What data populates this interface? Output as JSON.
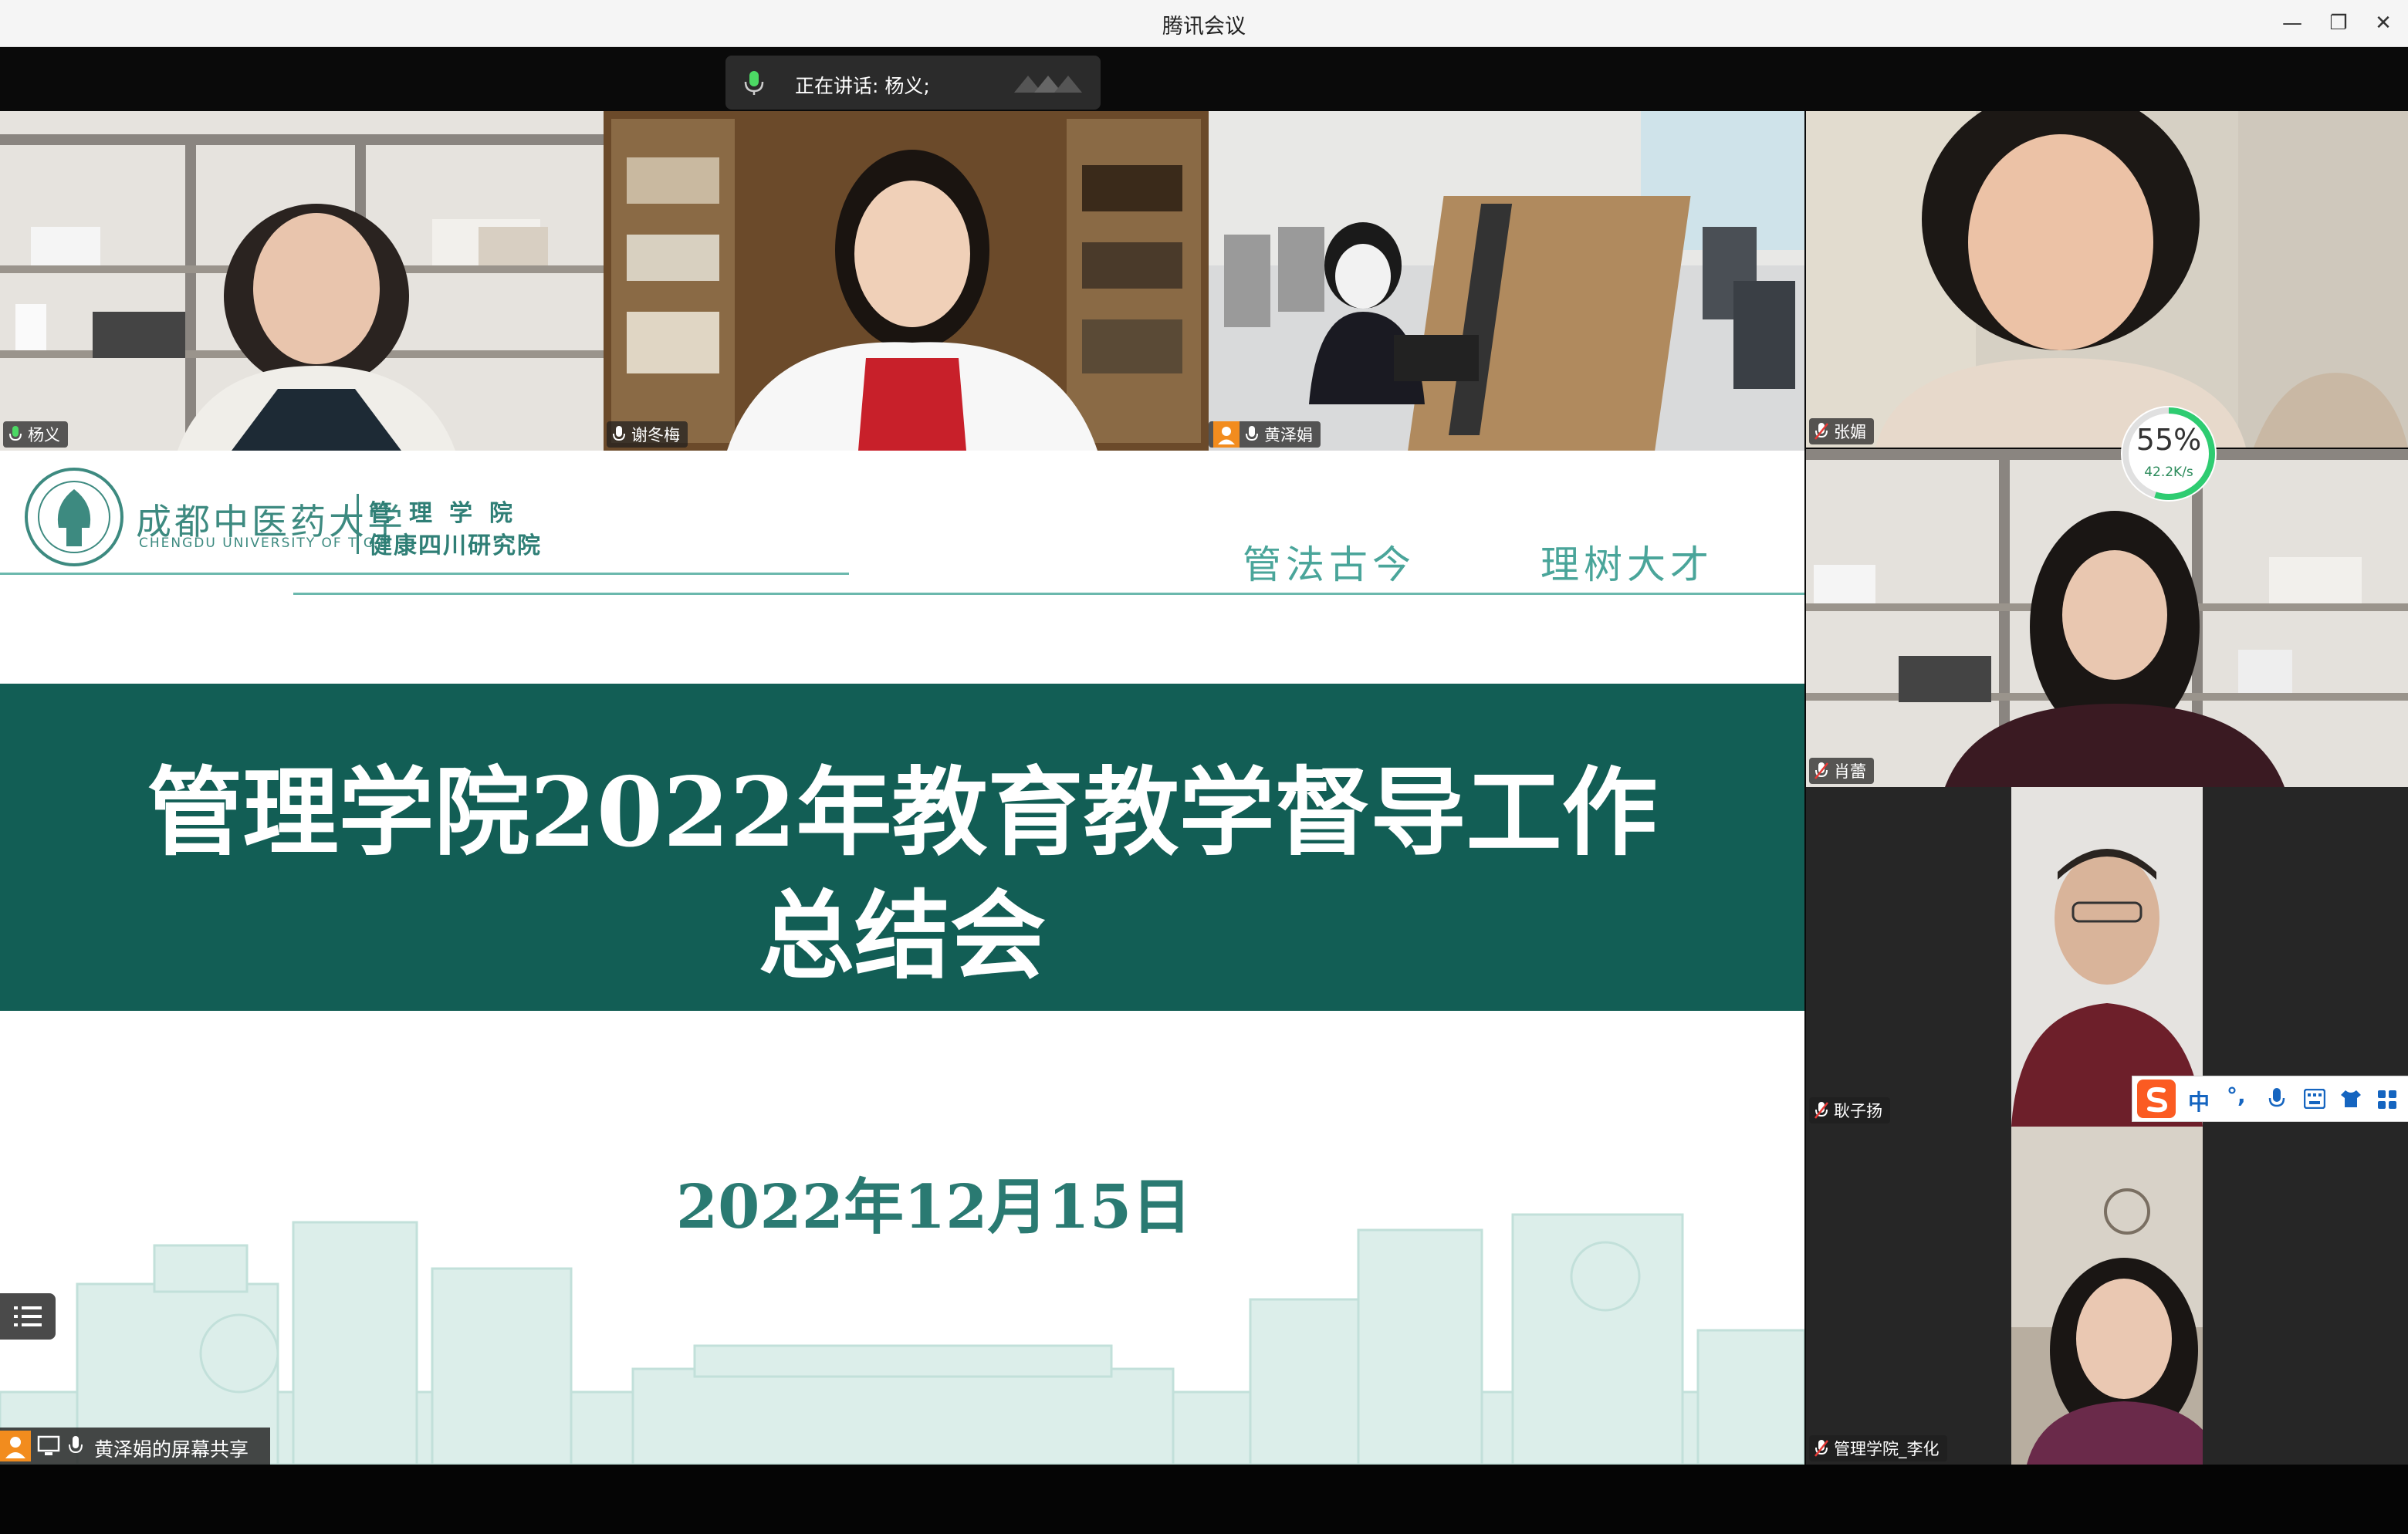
{
  "window": {
    "title": "腾讯会议",
    "minimize": "—",
    "restore": "❐",
    "close": "✕"
  },
  "speaking": {
    "label": "正在讲话: 杨义;"
  },
  "participants": [
    {
      "name": "杨义",
      "mic": "on"
    },
    {
      "name": "谢冬梅",
      "mic": "on"
    },
    {
      "name": "黄泽娟",
      "mic": "on",
      "host": true
    },
    {
      "name": "张媚",
      "mic": "muted"
    },
    {
      "name": "肖蕾",
      "mic": "muted"
    },
    {
      "name": "耿子扬",
      "mic": "muted"
    },
    {
      "name": "管理学院_李化",
      "mic": "muted"
    }
  ],
  "slide": {
    "university_cn": "成都中医药大学",
    "university_en": "CHENGDU UNIVERSITY OF T C M",
    "dept_line1": "管理学院",
    "dept_line2": "健康四川研究院",
    "slogan_1": "管法古今",
    "slogan_2": "理树大才",
    "title_line1": "管理学院2022年教育教学督导工作",
    "title_line2": "总结会",
    "date": "2022年12月15日"
  },
  "screen_share": {
    "label": "黄泽娟的屏幕共享"
  },
  "network": {
    "quality": "55%",
    "speed": "42.2K/s",
    "quality_value": 55
  },
  "ime": {
    "mode": "中",
    "punct": "°,"
  },
  "colors": {
    "banner": "#125e55",
    "accent": "#3d8a80",
    "speaking_mic": "#4cd964",
    "ring": "#2ecc71"
  }
}
